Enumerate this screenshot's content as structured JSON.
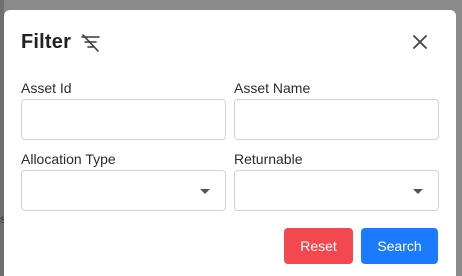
{
  "colors": {
    "reset_button_bg": "#f4474f",
    "search_button_bg": "#1a7bff",
    "overlay": "#8a8a8a"
  },
  "modal": {
    "title": "Filter",
    "title_icon": "filter-off-icon",
    "close_icon": "close-icon"
  },
  "fields": {
    "asset_id": {
      "label": "Asset Id",
      "value": "",
      "placeholder": ""
    },
    "asset_name": {
      "label": "Asset Name",
      "value": "",
      "placeholder": ""
    },
    "allocation_type": {
      "label": "Allocation Type",
      "selected": ""
    },
    "returnable": {
      "label": "Returnable",
      "selected": ""
    }
  },
  "actions": {
    "reset_label": "Reset",
    "search_label": "Search"
  }
}
